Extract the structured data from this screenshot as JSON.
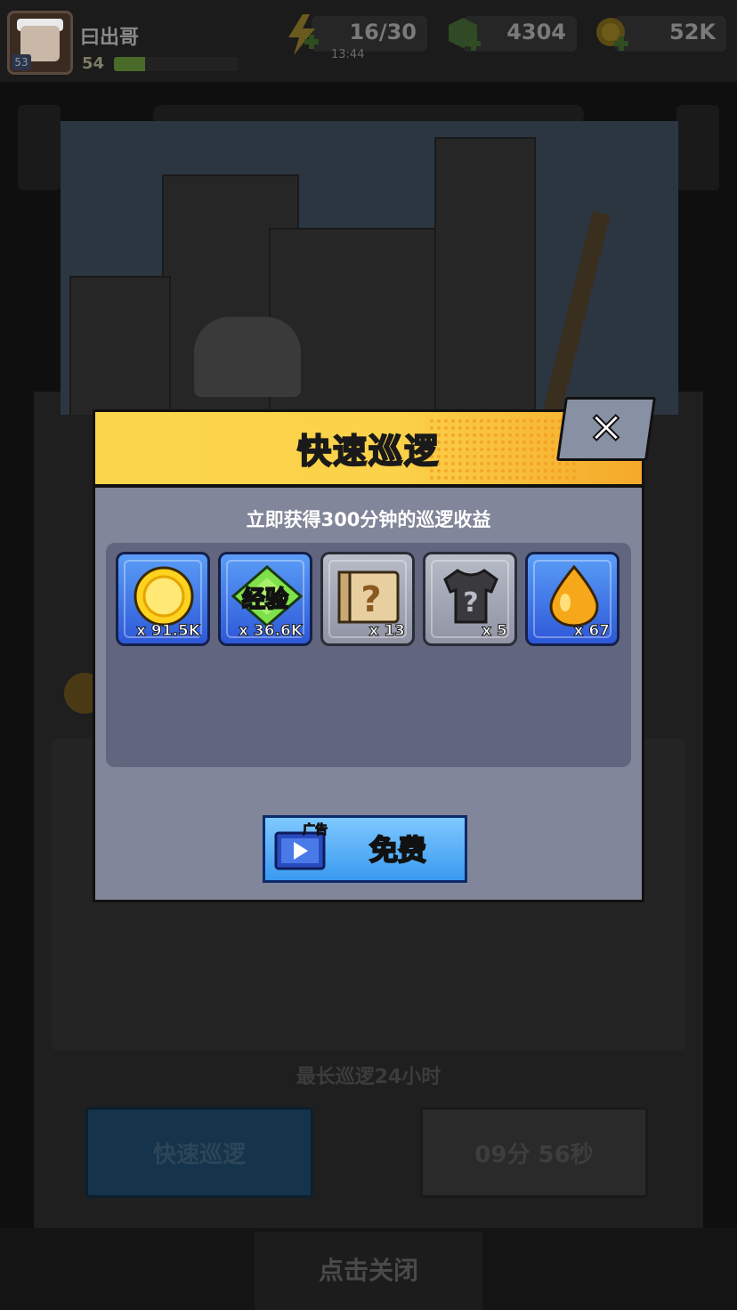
{
  "player": {
    "name": "曰出哥",
    "level": "54",
    "avatar_level": "53",
    "xp_fraction": 0.25
  },
  "resources": {
    "energy": {
      "value": "16/30",
      "timer": "13:44"
    },
    "gems": {
      "value": "4304"
    },
    "gold": {
      "value": "52K"
    }
  },
  "modal": {
    "title": "快速巡逻",
    "subtitle": "立即获得300分钟的巡逻收益",
    "close_icon": "close-icon",
    "rewards": [
      {
        "icon": "gold-coin-icon",
        "qty": "x 91.5K",
        "style": "blue"
      },
      {
        "icon": "exp-icon",
        "label": "经验",
        "qty": "x 36.6K",
        "style": "blue"
      },
      {
        "icon": "mystery-scroll-icon",
        "qty": "x 13",
        "style": "gray"
      },
      {
        "icon": "mystery-shirt-icon",
        "qty": "x 5",
        "style": "gray"
      },
      {
        "icon": "oil-drop-icon",
        "qty": "x 67",
        "style": "blue"
      }
    ],
    "ad_button": {
      "tag": "广告",
      "label": "免费"
    }
  },
  "background": {
    "max_patrol_hint": "最长巡逻24小时",
    "quick_patrol_button": "快速巡逻",
    "countdown_button": "09分 56秒",
    "tap_to_close": "点击关闭"
  },
  "colors": {
    "modal_header": "#fbd64c",
    "modal_body": "#81869a",
    "reward_blue": "#3a74e8",
    "ad_button": "#5ab0fa"
  }
}
